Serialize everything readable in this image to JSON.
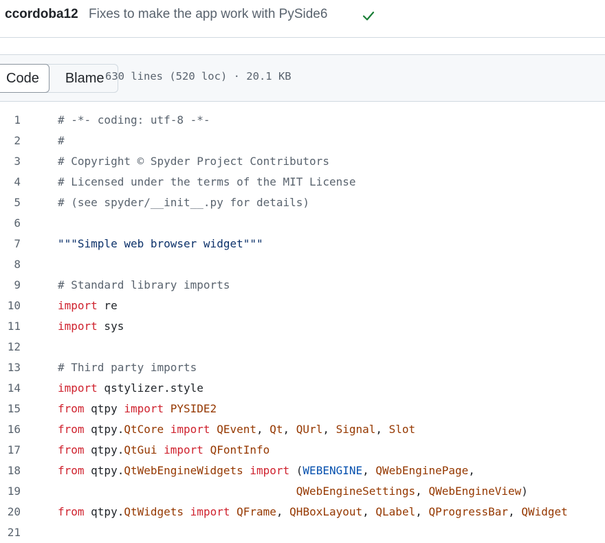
{
  "commit": {
    "author": "ccordoba12",
    "message": "Fixes to make the app work with PySide6",
    "status_icon": "check-icon",
    "status_color": "#1a7f37"
  },
  "toolbar": {
    "tabs": [
      {
        "label": "Code",
        "selected": true
      },
      {
        "label": "Blame",
        "selected": false
      }
    ],
    "file_info": "630 lines (520 loc) · 20.1 KB"
  },
  "code": {
    "lines": [
      {
        "num": "1",
        "tokens": [
          {
            "t": "# -*- coding: utf-8 -*-",
            "c": "c"
          }
        ]
      },
      {
        "num": "2",
        "tokens": [
          {
            "t": "#",
            "c": "c"
          }
        ]
      },
      {
        "num": "3",
        "tokens": [
          {
            "t": "# Copyright © Spyder Project Contributors",
            "c": "c"
          }
        ]
      },
      {
        "num": "4",
        "tokens": [
          {
            "t": "# Licensed under the terms of the MIT License",
            "c": "c"
          }
        ]
      },
      {
        "num": "5",
        "tokens": [
          {
            "t": "# (see spyder/__init__.py for details)",
            "c": "c"
          }
        ]
      },
      {
        "num": "6",
        "tokens": []
      },
      {
        "num": "7",
        "tokens": [
          {
            "t": "\"\"\"Simple web browser widget\"\"\"",
            "c": "s"
          }
        ]
      },
      {
        "num": "8",
        "tokens": []
      },
      {
        "num": "9",
        "tokens": [
          {
            "t": "# Standard library imports",
            "c": "c"
          }
        ]
      },
      {
        "num": "10",
        "tokens": [
          {
            "t": "import",
            "c": "k"
          },
          {
            "t": " re",
            "c": ""
          }
        ]
      },
      {
        "num": "11",
        "tokens": [
          {
            "t": "import",
            "c": "k"
          },
          {
            "t": " sys",
            "c": ""
          }
        ]
      },
      {
        "num": "12",
        "tokens": []
      },
      {
        "num": "13",
        "tokens": [
          {
            "t": "# Third party imports",
            "c": "c"
          }
        ]
      },
      {
        "num": "14",
        "tokens": [
          {
            "t": "import",
            "c": "k"
          },
          {
            "t": " qstylizer.style",
            "c": ""
          }
        ]
      },
      {
        "num": "15",
        "tokens": [
          {
            "t": "from",
            "c": "k"
          },
          {
            "t": " qtpy ",
            "c": ""
          },
          {
            "t": "import",
            "c": "k"
          },
          {
            "t": " PYSIDE2",
            "c": "n"
          }
        ]
      },
      {
        "num": "16",
        "tokens": [
          {
            "t": "from",
            "c": "k"
          },
          {
            "t": " qtpy.",
            "c": ""
          },
          {
            "t": "QtCore",
            "c": "n"
          },
          {
            "t": " ",
            "c": ""
          },
          {
            "t": "import",
            "c": "k"
          },
          {
            "t": " ",
            "c": ""
          },
          {
            "t": "QEvent",
            "c": "n"
          },
          {
            "t": ", ",
            "c": ""
          },
          {
            "t": "Qt",
            "c": "n"
          },
          {
            "t": ", ",
            "c": ""
          },
          {
            "t": "QUrl",
            "c": "n"
          },
          {
            "t": ", ",
            "c": ""
          },
          {
            "t": "Signal",
            "c": "n"
          },
          {
            "t": ", ",
            "c": ""
          },
          {
            "t": "Slot",
            "c": "n"
          }
        ]
      },
      {
        "num": "17",
        "tokens": [
          {
            "t": "from",
            "c": "k"
          },
          {
            "t": " qtpy.",
            "c": ""
          },
          {
            "t": "QtGui",
            "c": "n"
          },
          {
            "t": " ",
            "c": ""
          },
          {
            "t": "import",
            "c": "k"
          },
          {
            "t": " ",
            "c": ""
          },
          {
            "t": "QFontInfo",
            "c": "n"
          }
        ]
      },
      {
        "num": "18",
        "tokens": [
          {
            "t": "from",
            "c": "k"
          },
          {
            "t": " qtpy.",
            "c": ""
          },
          {
            "t": "QtWebEngineWidgets",
            "c": "n"
          },
          {
            "t": " ",
            "c": ""
          },
          {
            "t": "import",
            "c": "k"
          },
          {
            "t": " (",
            "c": ""
          },
          {
            "t": "WEBENGINE",
            "c": "b"
          },
          {
            "t": ", ",
            "c": ""
          },
          {
            "t": "QWebEnginePage",
            "c": "n"
          },
          {
            "t": ",",
            "c": ""
          }
        ]
      },
      {
        "num": "19",
        "tokens": [
          {
            "t": "                                    ",
            "c": ""
          },
          {
            "t": "QWebEngineSettings",
            "c": "n"
          },
          {
            "t": ", ",
            "c": ""
          },
          {
            "t": "QWebEngineView",
            "c": "n"
          },
          {
            "t": ")",
            "c": ""
          }
        ]
      },
      {
        "num": "20",
        "tokens": [
          {
            "t": "from",
            "c": "k"
          },
          {
            "t": " qtpy.",
            "c": ""
          },
          {
            "t": "QtWidgets",
            "c": "n"
          },
          {
            "t": " ",
            "c": ""
          },
          {
            "t": "import",
            "c": "k"
          },
          {
            "t": " ",
            "c": ""
          },
          {
            "t": "QFrame",
            "c": "n"
          },
          {
            "t": ", ",
            "c": ""
          },
          {
            "t": "QHBoxLayout",
            "c": "n"
          },
          {
            "t": ", ",
            "c": ""
          },
          {
            "t": "QLabel",
            "c": "n"
          },
          {
            "t": ", ",
            "c": ""
          },
          {
            "t": "QProgressBar",
            "c": "n"
          },
          {
            "t": ", ",
            "c": ""
          },
          {
            "t": "QWidget",
            "c": "n"
          }
        ]
      },
      {
        "num": "21",
        "tokens": []
      }
    ]
  }
}
